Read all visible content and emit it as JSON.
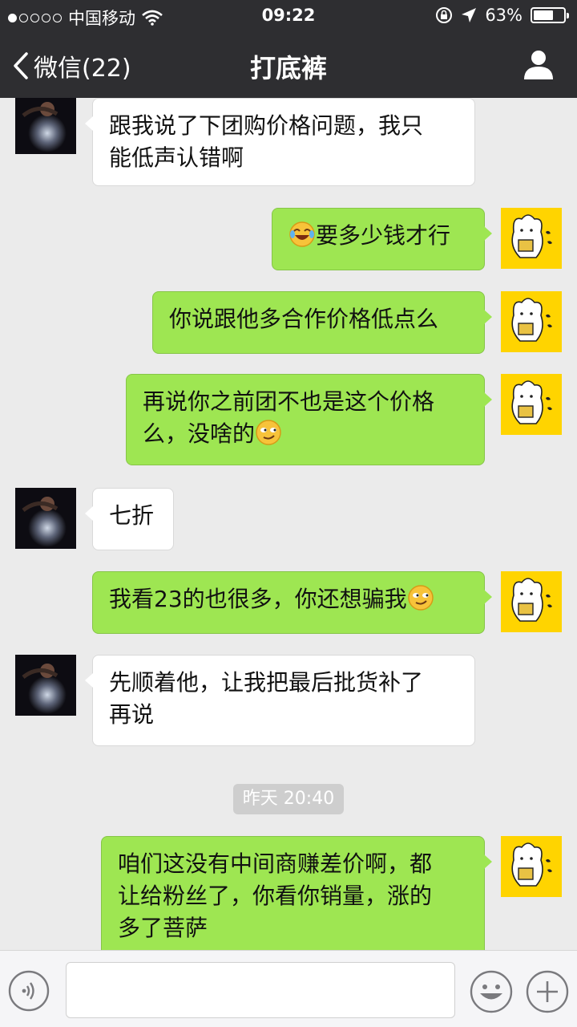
{
  "status_bar": {
    "carrier": "中国移动",
    "time": "09:22",
    "battery": "63%",
    "battery_level": 0.63,
    "signal_bars": 1
  },
  "nav": {
    "back_label": "微信(22)",
    "title": "打底裤"
  },
  "messages": [
    {
      "side": "in",
      "lines": [
        "跟我说了下团购价格问题，我只",
        "能低声认错啊"
      ]
    },
    {
      "side": "out",
      "prefix_emoji": "laugh-cry-emoji",
      "lines": [
        "要多少钱才行"
      ]
    },
    {
      "side": "out",
      "lines": [
        "你说跟他多合作价格低点么"
      ]
    },
    {
      "side": "out",
      "lines": [
        "再说你之前团不也是这个价格",
        "么，没啥的"
      ],
      "suffix_emoji": "smirk-emoji"
    },
    {
      "side": "in",
      "lines": [
        "七折"
      ]
    },
    {
      "side": "out",
      "lines": [
        "我看23的也很多，你还想骗我"
      ],
      "suffix_emoji": "smirk-emoji"
    },
    {
      "side": "in",
      "lines": [
        "先顺着他，让我把最后批货补了",
        "再说"
      ]
    },
    {
      "side": "out",
      "lines": [
        "咱们这没有中间商赚差价啊，都",
        "让给粉丝了，你看你销量，涨的",
        "多了菩萨"
      ]
    }
  ],
  "timestamp": "昨天 20:40",
  "colors": {
    "nav_bg": "#2e2e31",
    "chat_bg": "#ebebeb",
    "outgoing_bubble": "#9ee652",
    "incoming_bubble": "#ffffff",
    "time_pill": "#cecece"
  },
  "icons": {
    "back": "chevron-left-icon",
    "profile": "person-icon",
    "wifi": "wifi-icon",
    "lock": "rotation-lock-icon",
    "location": "location-arrow-icon",
    "voice": "voice-icon",
    "emoji": "emoji-icon",
    "plus": "plus-icon"
  }
}
